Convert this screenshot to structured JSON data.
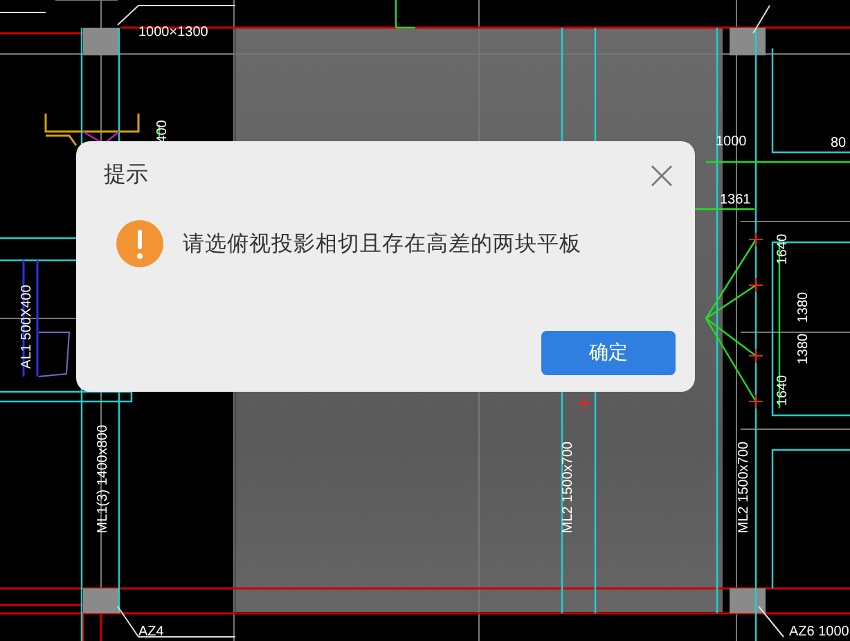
{
  "drawing": {
    "labels": [
      {
        "text": "1000×1300",
        "kind": "horizontal"
      },
      {
        "text": "400",
        "kind": "vertical"
      },
      {
        "text": "1000",
        "kind": "horizontal"
      },
      {
        "text": "80",
        "kind": "horizontal"
      },
      {
        "text": "1361",
        "kind": "horizontal"
      },
      {
        "text": "1640",
        "kind": "vertical"
      },
      {
        "text": "1380",
        "kind": "vertical"
      },
      {
        "text": "1380",
        "kind": "vertical"
      },
      {
        "text": "1640",
        "kind": "vertical"
      },
      {
        "text": "AL1 500X400",
        "kind": "vertical"
      },
      {
        "text": "ML1(3) 1400x800",
        "kind": "vertical"
      },
      {
        "text": "ML2 1500x700",
        "kind": "vertical"
      },
      {
        "text": "ML2 1500x700",
        "kind": "vertical"
      },
      {
        "text": "AZ4",
        "kind": "horizontal"
      },
      {
        "text": "AZ6 1000",
        "kind": "horizontal"
      }
    ]
  },
  "dialog": {
    "title": "提示",
    "message": "请选俯视投影相切且存在高差的两块平板",
    "buttons": [
      {
        "label": "确定",
        "kind": "primary"
      }
    ]
  }
}
